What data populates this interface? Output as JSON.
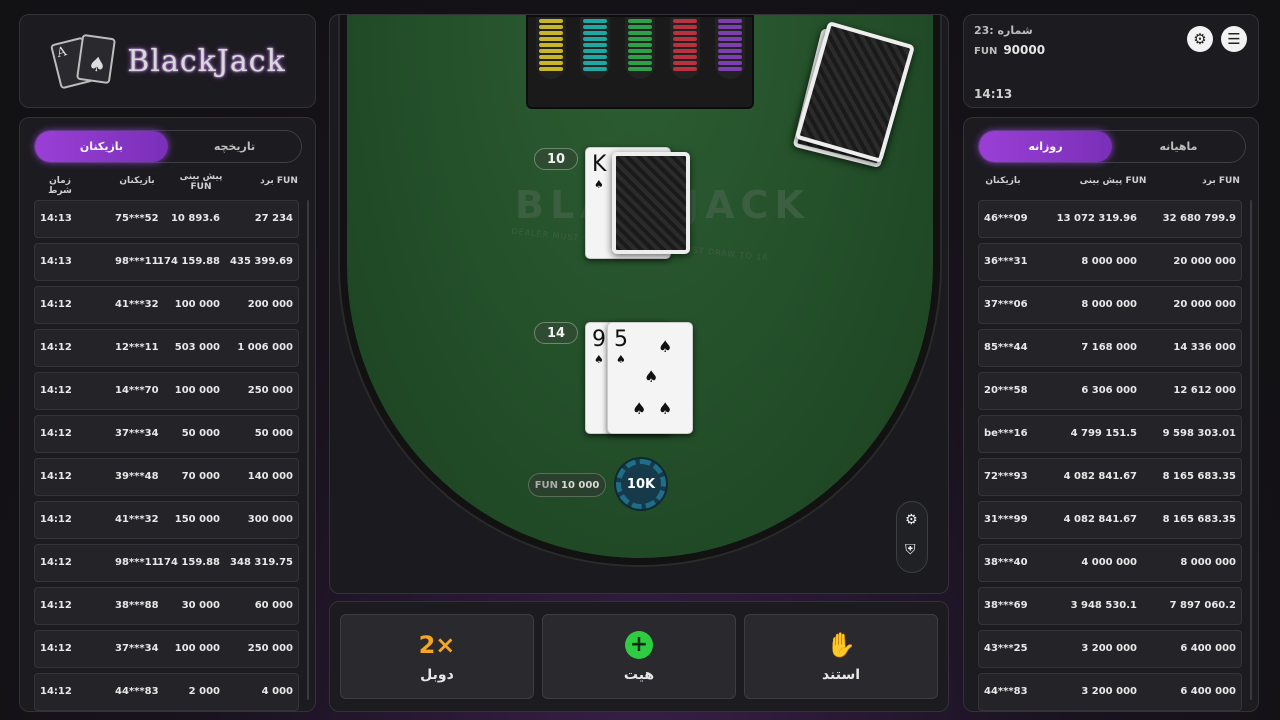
{
  "logo": {
    "text": "BlackJack",
    "card_rank": "A",
    "card_suit": "♠"
  },
  "colors": {
    "accent": "#9a3fd6",
    "felt": "#2d5e33",
    "double": "#f5a623",
    "hit": "#2ecc40",
    "stand": "#ff5a2a"
  },
  "left": {
    "tabs": [
      {
        "label": "تاریخچه",
        "active": false
      },
      {
        "label": "بازیکنان",
        "active": true
      }
    ],
    "headers": {
      "win": "برد FUN",
      "bet": "پیش بینی",
      "bet_sub": "FUN",
      "player": "بازیکنان",
      "time": "زمان شرط"
    },
    "rows": [
      {
        "win": "27 234",
        "bet": "10 893.6",
        "player": "75***52",
        "time": "14:13"
      },
      {
        "win": "435 399.69",
        "bet": "174 159.88",
        "player": "98***11",
        "time": "14:13"
      },
      {
        "win": "200 000",
        "bet": "100 000",
        "player": "41***32",
        "time": "14:12"
      },
      {
        "win": "1 006 000",
        "bet": "503 000",
        "player": "12***11",
        "time": "14:12"
      },
      {
        "win": "250 000",
        "bet": "100 000",
        "player": "14***70",
        "time": "14:12"
      },
      {
        "win": "50 000",
        "bet": "50 000",
        "player": "37***34",
        "time": "14:12"
      },
      {
        "win": "140 000",
        "bet": "70 000",
        "player": "39***48",
        "time": "14:12"
      },
      {
        "win": "300 000",
        "bet": "150 000",
        "player": "41***32",
        "time": "14:12"
      },
      {
        "win": "348 319.75",
        "bet": "174 159.88",
        "player": "98***11",
        "time": "14:12"
      },
      {
        "win": "60 000",
        "bet": "30 000",
        "player": "38***88",
        "time": "14:12"
      },
      {
        "win": "250 000",
        "bet": "100 000",
        "player": "37***34",
        "time": "14:12"
      },
      {
        "win": "4 000",
        "bet": "2 000",
        "player": "44***83",
        "time": "14:12"
      }
    ]
  },
  "right": {
    "tabs": [
      {
        "label": "ماهیانه",
        "active": false
      },
      {
        "label": "روزانه",
        "active": true
      }
    ],
    "headers": {
      "win": "برد FUN",
      "bet": "پیش بینی FUN",
      "player": "بازیکنان"
    },
    "rows": [
      {
        "win": "32 680 799.9",
        "bet": "13 072 319.96",
        "player": "46***09"
      },
      {
        "win": "20 000 000",
        "bet": "8 000 000",
        "player": "36***31"
      },
      {
        "win": "20 000 000",
        "bet": "8 000 000",
        "player": "37***06"
      },
      {
        "win": "14 336 000",
        "bet": "7 168 000",
        "player": "85***44"
      },
      {
        "win": "12 612 000",
        "bet": "6 306 000",
        "player": "20***58"
      },
      {
        "win": "9 598 303.01",
        "bet": "4 799 151.5",
        "player": "be***16"
      },
      {
        "win": "8 165 683.35",
        "bet": "4 082 841.67",
        "player": "72***93"
      },
      {
        "win": "8 165 683.35",
        "bet": "4 082 841.67",
        "player": "31***99"
      },
      {
        "win": "8 000 000",
        "bet": "4 000 000",
        "player": "38***40"
      },
      {
        "win": "7 897 060.2",
        "bet": "3 948 530.1",
        "player": "38***69"
      },
      {
        "win": "6 400 000",
        "bet": "3 200 000",
        "player": "43***25"
      },
      {
        "win": "6 400 000",
        "bet": "3 200 000",
        "player": "44***83"
      }
    ]
  },
  "info": {
    "round": "23: شماره",
    "currency": "FUN",
    "balance": "90000",
    "time": "14:13"
  },
  "table": {
    "watermark": "BLACKJACK",
    "watermark_sub": "DEALER MUST STAND TO 17, AND MUST DRAW TO 16",
    "dealer_score": "10",
    "dealer_card": {
      "rank": "K",
      "suit": "♠"
    },
    "player_score": "14",
    "player_cards": [
      {
        "rank": "9",
        "suit": "♠"
      },
      {
        "rank": "5",
        "suit": "♠"
      }
    ],
    "bet_currency": "FUN",
    "bet_amount": "10 000",
    "chip_label": "10K"
  },
  "actions": {
    "double": {
      "label": "دوبل",
      "icon": "2×"
    },
    "hit": {
      "label": "هیت",
      "icon": "+"
    },
    "stand": {
      "label": "استند",
      "icon": "✋"
    }
  }
}
